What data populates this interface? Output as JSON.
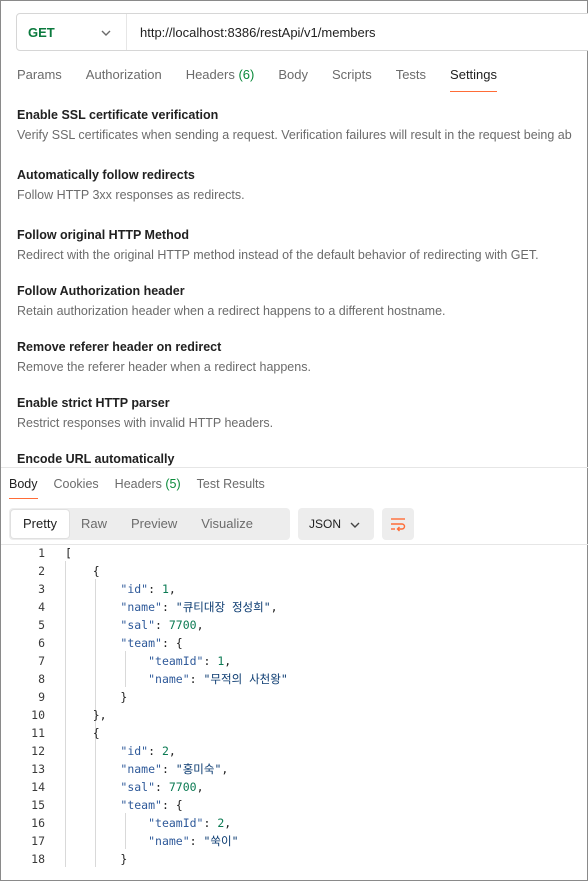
{
  "request": {
    "method": "GET",
    "url": "http://localhost:8386/restApi/v1/members"
  },
  "request_tabs": [
    {
      "label": "Params"
    },
    {
      "label": "Authorization"
    },
    {
      "label": "Headers",
      "count": " (6)"
    },
    {
      "label": "Body"
    },
    {
      "label": "Scripts"
    },
    {
      "label": "Tests"
    },
    {
      "label": "Settings",
      "active": true
    }
  ],
  "settings": [
    {
      "title": "Enable SSL certificate verification",
      "desc": "Verify SSL certificates when sending a request. Verification failures will result in the request being ab"
    },
    {
      "title": "Automatically follow redirects",
      "desc": "Follow HTTP 3xx responses as redirects."
    },
    {
      "title": "Follow original HTTP Method",
      "desc": "Redirect with the original HTTP method instead of the default behavior of redirecting with GET."
    },
    {
      "title": "Follow Authorization header",
      "desc": "Retain authorization header when a redirect happens to a different hostname."
    },
    {
      "title": "Remove referer header on redirect",
      "desc": "Remove the referer header when a redirect happens."
    },
    {
      "title": "Enable strict HTTP parser",
      "desc": "Restrict responses with invalid HTTP headers."
    },
    {
      "title": "Encode URL automatically",
      "desc": ""
    }
  ],
  "response_tabs": [
    {
      "label": "Body",
      "active": true
    },
    {
      "label": "Cookies"
    },
    {
      "label": "Headers",
      "count": " (5)"
    },
    {
      "label": "Test Results"
    }
  ],
  "view_modes": [
    "Pretty",
    "Raw",
    "Preview",
    "Visualize"
  ],
  "format": "JSON",
  "icons": {
    "method_dropdown": "chevron-down-icon",
    "format_dropdown": "chevron-down-icon",
    "wrap": "wrap-lines-icon"
  },
  "colors": {
    "accent": "#ff6c37",
    "method": "#0b7a3e",
    "count": "#0b8a3b"
  },
  "code_lines": [
    [
      {
        "t": "p",
        "v": "["
      }
    ],
    [
      {
        "t": "p",
        "v": "    {"
      }
    ],
    [
      {
        "t": "p",
        "v": "        "
      },
      {
        "t": "k",
        "v": "\"id\""
      },
      {
        "t": "p",
        "v": ": "
      },
      {
        "t": "n",
        "v": "1"
      },
      {
        "t": "p",
        "v": ","
      }
    ],
    [
      {
        "t": "p",
        "v": "        "
      },
      {
        "t": "k",
        "v": "\"name\""
      },
      {
        "t": "p",
        "v": ": "
      },
      {
        "t": "s",
        "v": "\"큐티대장 정성희\""
      },
      {
        "t": "p",
        "v": ","
      }
    ],
    [
      {
        "t": "p",
        "v": "        "
      },
      {
        "t": "k",
        "v": "\"sal\""
      },
      {
        "t": "p",
        "v": ": "
      },
      {
        "t": "n",
        "v": "7700"
      },
      {
        "t": "p",
        "v": ","
      }
    ],
    [
      {
        "t": "p",
        "v": "        "
      },
      {
        "t": "k",
        "v": "\"team\""
      },
      {
        "t": "p",
        "v": ": {"
      }
    ],
    [
      {
        "t": "p",
        "v": "            "
      },
      {
        "t": "k",
        "v": "\"teamId\""
      },
      {
        "t": "p",
        "v": ": "
      },
      {
        "t": "n",
        "v": "1"
      },
      {
        "t": "p",
        "v": ","
      }
    ],
    [
      {
        "t": "p",
        "v": "            "
      },
      {
        "t": "k",
        "v": "\"name\""
      },
      {
        "t": "p",
        "v": ": "
      },
      {
        "t": "s",
        "v": "\"무적의 사천왕\""
      }
    ],
    [
      {
        "t": "p",
        "v": "        }"
      }
    ],
    [
      {
        "t": "p",
        "v": "    },"
      }
    ],
    [
      {
        "t": "p",
        "v": "    {"
      }
    ],
    [
      {
        "t": "p",
        "v": "        "
      },
      {
        "t": "k",
        "v": "\"id\""
      },
      {
        "t": "p",
        "v": ": "
      },
      {
        "t": "n",
        "v": "2"
      },
      {
        "t": "p",
        "v": ","
      }
    ],
    [
      {
        "t": "p",
        "v": "        "
      },
      {
        "t": "k",
        "v": "\"name\""
      },
      {
        "t": "p",
        "v": ": "
      },
      {
        "t": "s",
        "v": "\"홍미숙\""
      },
      {
        "t": "p",
        "v": ","
      }
    ],
    [
      {
        "t": "p",
        "v": "        "
      },
      {
        "t": "k",
        "v": "\"sal\""
      },
      {
        "t": "p",
        "v": ": "
      },
      {
        "t": "n",
        "v": "7700"
      },
      {
        "t": "p",
        "v": ","
      }
    ],
    [
      {
        "t": "p",
        "v": "        "
      },
      {
        "t": "k",
        "v": "\"team\""
      },
      {
        "t": "p",
        "v": ": {"
      }
    ],
    [
      {
        "t": "p",
        "v": "            "
      },
      {
        "t": "k",
        "v": "\"teamId\""
      },
      {
        "t": "p",
        "v": ": "
      },
      {
        "t": "n",
        "v": "2"
      },
      {
        "t": "p",
        "v": ","
      }
    ],
    [
      {
        "t": "p",
        "v": "            "
      },
      {
        "t": "k",
        "v": "\"name\""
      },
      {
        "t": "p",
        "v": ": "
      },
      {
        "t": "s",
        "v": "\"쑥이\""
      }
    ],
    [
      {
        "t": "p",
        "v": "        }"
      }
    ]
  ]
}
